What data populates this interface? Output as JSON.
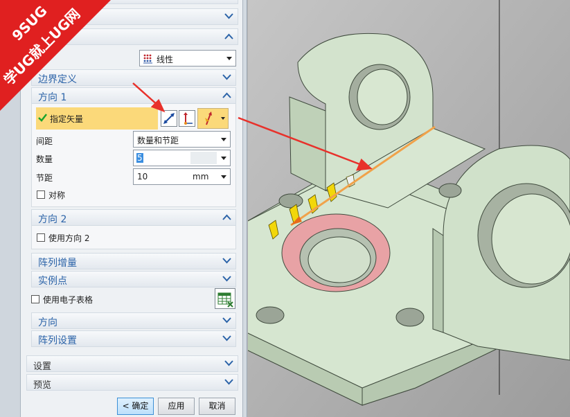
{
  "watermark": {
    "line1": "9SUG",
    "line2": "学UG就上UG网"
  },
  "pattern_layout": {
    "value": "线性"
  },
  "sections": {
    "boundary": "边界定义",
    "direction1": "方向 1",
    "direction2": "方向 2",
    "pattern_increment": "阵列增量",
    "instance_points": "实例点",
    "orientation": "方向",
    "pattern_settings": "阵列设置",
    "settings": "设置",
    "preview": "预览"
  },
  "direction1": {
    "specify_vector": "指定矢量",
    "spacing_label": "间距",
    "spacing_value": "数量和节距",
    "count_label": "数量",
    "count_value": "5",
    "pitch_label": "节距",
    "pitch_value": "10",
    "pitch_unit": "mm",
    "symmetric_label": "对称"
  },
  "direction2": {
    "use_label": "使用方向 2"
  },
  "spreadsheet": {
    "label": "使用电子表格"
  },
  "footer": {
    "ok": "< 确定 >",
    "apply": "应用",
    "cancel": "取消"
  },
  "colors": {
    "accent": "#2b63a8",
    "highlight": "#fbd97a",
    "part": "#d3e3cf",
    "ring": "#e8a2a5",
    "arrow": "#e8312b"
  }
}
